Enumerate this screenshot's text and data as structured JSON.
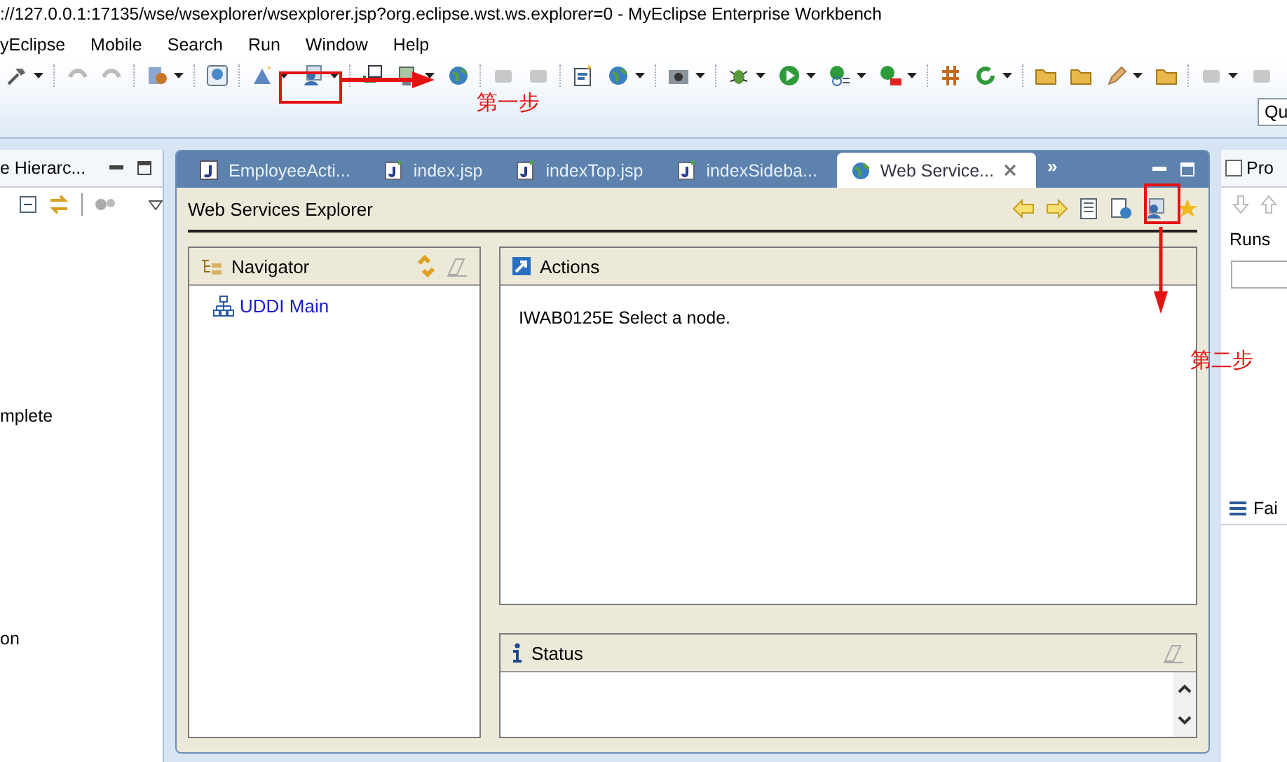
{
  "window": {
    "title": "://127.0.0.1:17135/wse/wsexplorer/wsexplorer.jsp?org.eclipse.wst.ws.explorer=0 - MyEclipse Enterprise Workbench"
  },
  "menu": [
    {
      "label": "yEclipse"
    },
    {
      "label": "Mobile"
    },
    {
      "label": "Search"
    },
    {
      "label": "Run"
    },
    {
      "label": "Window"
    },
    {
      "label": "Help"
    }
  ],
  "quick_access": {
    "placeholder": "Qu"
  },
  "left_panel": {
    "tab": "e Hierarc...",
    "lines": [
      "mplete",
      "on"
    ]
  },
  "editor": {
    "tabs": [
      {
        "label": "EmployeeActi...",
        "kind": "java",
        "selected": false
      },
      {
        "label": "index.jsp",
        "kind": "jsp",
        "selected": false
      },
      {
        "label": "indexTop.jsp",
        "kind": "jsp",
        "selected": false
      },
      {
        "label": "indexSideba...",
        "kind": "jsp",
        "selected": false
      },
      {
        "label": "Web Service...",
        "kind": "web",
        "selected": true
      }
    ],
    "overflow": "»"
  },
  "explorer": {
    "title": "Web Services Explorer",
    "navigator": {
      "title": "Navigator",
      "items": [
        {
          "label": "UDDI Main"
        }
      ]
    },
    "actions": {
      "title": "Actions",
      "message": "IWAB0125E Select a node."
    },
    "status": {
      "title": "Status"
    }
  },
  "right_panel": {
    "tab": "Pro",
    "label": "Runs",
    "section": "Fai"
  },
  "annotations": [
    {
      "label": "第一步"
    },
    {
      "label": "第二步"
    }
  ]
}
